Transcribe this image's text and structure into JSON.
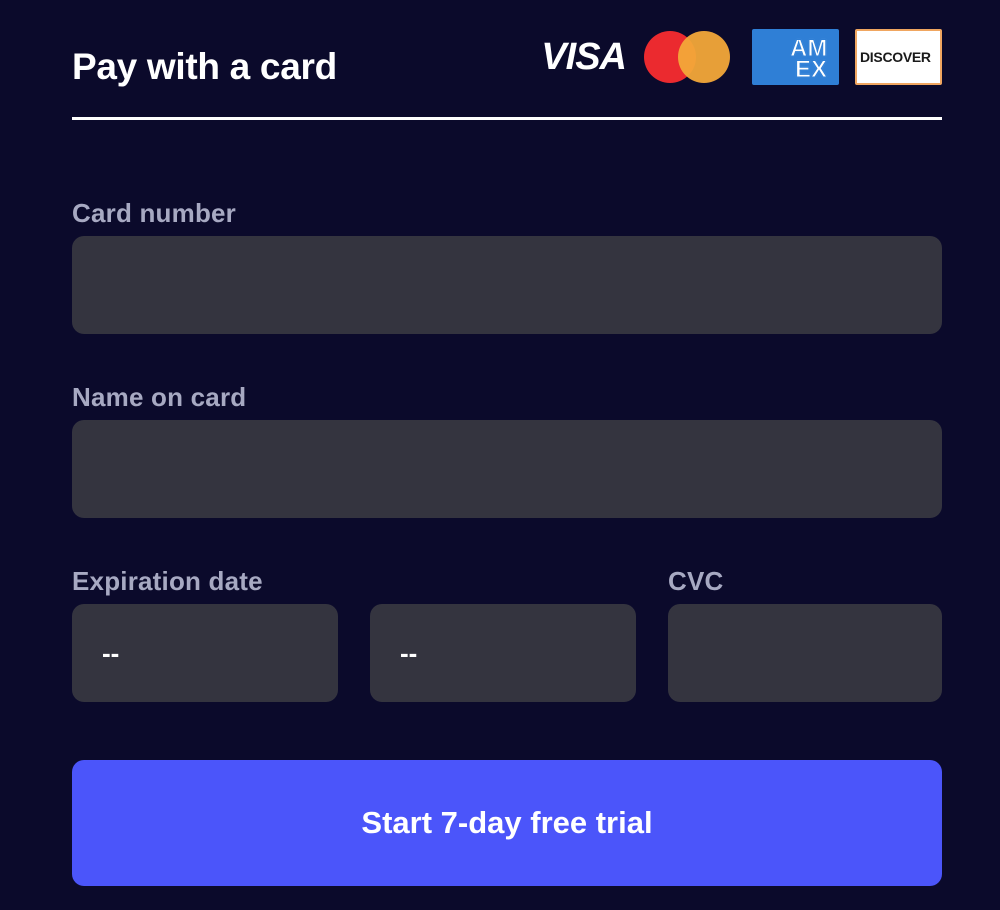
{
  "header": {
    "title": "Pay with a card",
    "brands": [
      {
        "name": "visa",
        "label": "VISA"
      },
      {
        "name": "mastercard",
        "label": ""
      },
      {
        "name": "amex",
        "label_top": "AM",
        "label_bottom": "EX"
      },
      {
        "name": "discover",
        "label": "DISCOVER"
      }
    ]
  },
  "form": {
    "card_number": {
      "label": "Card number",
      "value": "",
      "placeholder": ""
    },
    "name_on_card": {
      "label": "Name on card",
      "value": "",
      "placeholder": ""
    },
    "expiration": {
      "label": "Expiration date",
      "month_value": "--",
      "year_value": "--"
    },
    "cvc": {
      "label": "CVC",
      "value": "",
      "placeholder": ""
    }
  },
  "cta": {
    "label": "Start 7-day free trial"
  },
  "colors": {
    "background": "#0b0a2b",
    "field": "#34343f",
    "label": "#a7a9c2",
    "accent": "#4b55fa"
  }
}
